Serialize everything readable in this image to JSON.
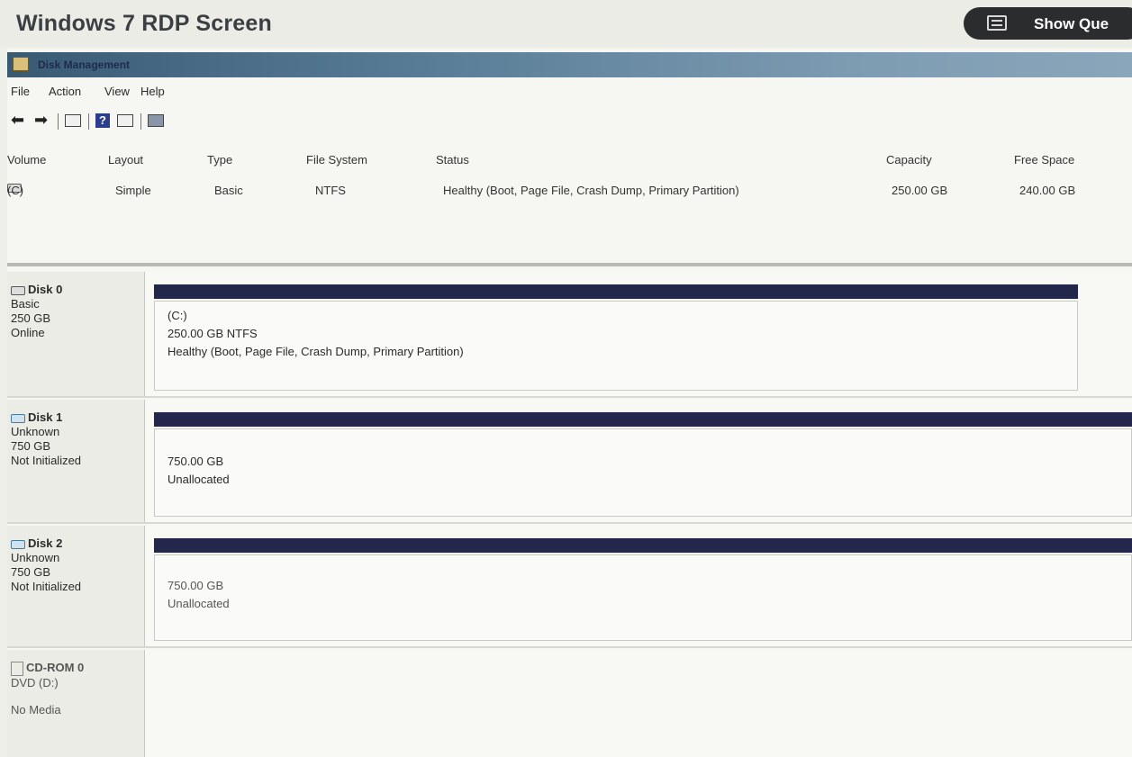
{
  "page_title": "Windows 7 RDP Screen",
  "show_button_label": "Show Que",
  "window": {
    "title": "Disk Management",
    "menu": [
      "File",
      "Action",
      "View",
      "Help"
    ]
  },
  "volume_table": {
    "headers": [
      "Volume",
      "Layout",
      "Type",
      "File System",
      "Status",
      "Capacity",
      "Free Space"
    ],
    "rows": [
      [
        "(C)",
        "Simple",
        "Basic",
        "NTFS",
        "Healthy (Boot, Page File, Crash Dump, Primary Partition)",
        "250.00 GB",
        "240.00 GB"
      ]
    ]
  },
  "disks": [
    {
      "name": "Disk 0",
      "type": "Basic",
      "size": "250 GB",
      "status": "Online",
      "partition_name": "(C:)",
      "partition_size": "250.00 GB NTFS",
      "partition_status": "Healthy (Boot, Page File, Crash Dump, Primary Partition)"
    },
    {
      "name": "Disk 1",
      "type": "Unknown",
      "size": "750 GB",
      "status": "Not Initialized",
      "partition_size": "750.00 GB",
      "partition_status": "Unallocated"
    },
    {
      "name": "Disk 2",
      "type": "Unknown",
      "size": "750 GB",
      "status": "Not Initialized",
      "partition_size": "750.00 GB",
      "partition_status": "Unallocated"
    },
    {
      "name": "CD-ROM 0",
      "type": "DVD (D:)",
      "status": "No Media"
    }
  ],
  "colors": {
    "titlebar": "#4e7290",
    "disk_bar": "#22274b",
    "show_button": "#2a2c2e"
  },
  "icons": {
    "toolbar": [
      "back-arrow-icon",
      "forward-arrow-icon",
      "console-tree-icon",
      "help-icon",
      "properties-icon",
      "settings-icon"
    ]
  }
}
